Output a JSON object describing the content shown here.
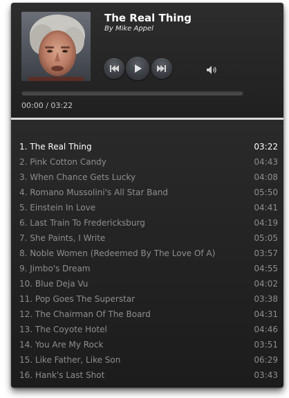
{
  "now_playing": {
    "title": "The Real Thing",
    "artist": "By Mike Appel",
    "time_display": "00:00 / 03:22",
    "progress_fraction": 0.0
  },
  "controls": {
    "previous_icon": "previous-track-icon",
    "play_icon": "play-icon",
    "next_icon": "next-track-icon",
    "volume_icon": "volume-icon"
  },
  "colors": {
    "panel": "#1f1f1f",
    "active_text": "#ffffff",
    "inactive_text": "#8e8e8e"
  },
  "playlist": {
    "active_index": 0,
    "tracks": [
      {
        "label": "1. The Real Thing",
        "duration": "03:22"
      },
      {
        "label": "2. Pink Cotton Candy",
        "duration": "04:43"
      },
      {
        "label": "3. When Chance Gets Lucky",
        "duration": "04:08"
      },
      {
        "label": "4. Romano Mussolini's All Star Band",
        "duration": "05:50"
      },
      {
        "label": "5. Einstein In Love",
        "duration": "04:41"
      },
      {
        "label": "6. Last Train To Fredericksburg",
        "duration": "04:19"
      },
      {
        "label": "7. She Paints, I Write",
        "duration": "05:05"
      },
      {
        "label": "8. Noble Women (Redeemed By The Love Of A)",
        "duration": "03:57"
      },
      {
        "label": "9. Jimbo's Dream",
        "duration": "04:55"
      },
      {
        "label": "10. Blue Deja Vu",
        "duration": "04:02"
      },
      {
        "label": "11. Pop Goes The Superstar",
        "duration": "03:38"
      },
      {
        "label": "12. The Chairman Of The Board",
        "duration": "04:31"
      },
      {
        "label": "13. The Coyote Hotel",
        "duration": "04:46"
      },
      {
        "label": "14. You Are My Rock",
        "duration": "03:51"
      },
      {
        "label": "15. Like Father, Like Son",
        "duration": "06:29"
      },
      {
        "label": "16. Hank's Last Shot",
        "duration": "03:43"
      }
    ]
  }
}
